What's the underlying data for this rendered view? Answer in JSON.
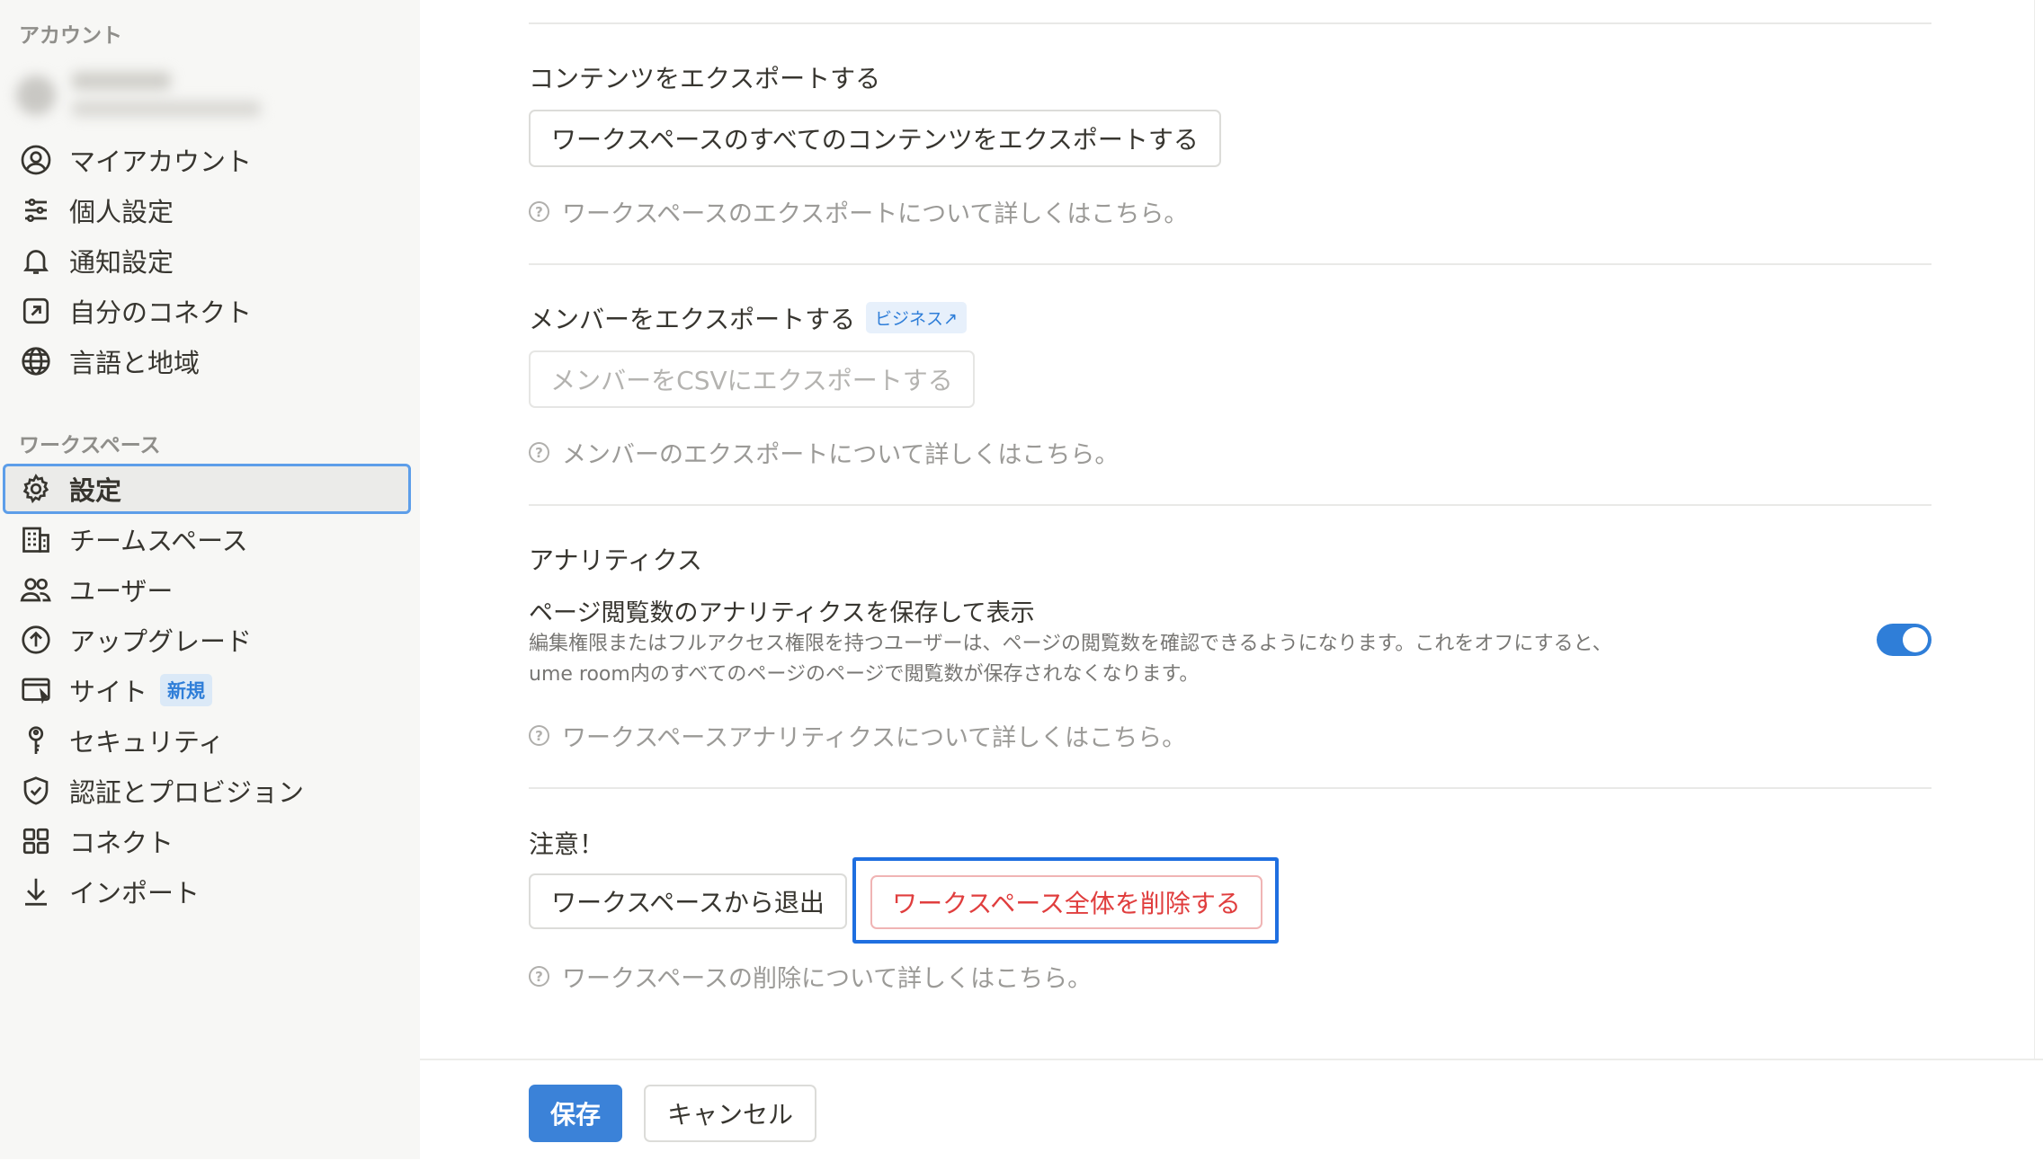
{
  "sidebar": {
    "account_heading": "アカウント",
    "account_items": [
      {
        "label": "マイアカウント",
        "icon": "user-circle-icon"
      },
      {
        "label": "個人設定",
        "icon": "sliders-icon"
      },
      {
        "label": "通知設定",
        "icon": "bell-icon"
      },
      {
        "label": "自分のコネクト",
        "icon": "arrow-box-icon"
      },
      {
        "label": "言語と地域",
        "icon": "globe-icon"
      }
    ],
    "workspace_heading": "ワークスペース",
    "workspace_items": [
      {
        "label": "設定",
        "icon": "gear-icon",
        "active": true
      },
      {
        "label": "チームスペース",
        "icon": "building-icon"
      },
      {
        "label": "ユーザー",
        "icon": "users-icon"
      },
      {
        "label": "アップグレード",
        "icon": "arrow-up-circle-icon"
      },
      {
        "label": "サイト",
        "icon": "browser-icon",
        "badge": "新規"
      },
      {
        "label": "セキュリティ",
        "icon": "key-icon"
      },
      {
        "label": "認証とプロビジョン",
        "icon": "shield-check-icon"
      },
      {
        "label": "コネクト",
        "icon": "grid-icon"
      },
      {
        "label": "インポート",
        "icon": "download-icon"
      }
    ]
  },
  "export_content": {
    "title": "コンテンツをエクスポートする",
    "button": "ワークスペースのすべてのコンテンツをエクスポートする",
    "help": "ワークスペースのエクスポートについて詳しくはこちら。"
  },
  "export_members": {
    "title": "メンバーをエクスポートする",
    "badge": "ビジネス↗",
    "button": "メンバーをCSVにエクスポートする",
    "help": "メンバーのエクスポートについて詳しくはこちら。"
  },
  "analytics": {
    "title": "アナリティクス",
    "setting_title": "ページ閲覧数のアナリティクスを保存して表示",
    "desc_line1": "編集権限またはフルアクセス権限を持つユーザーは、ページの閲覧数を確認できるようになります。これをオフにすると、",
    "desc_line2": "ume room内のすべてのページのページで閲覧数が保存されなくなります。",
    "toggle_on": true,
    "help": "ワークスペースアナリティクスについて詳しくはこちら。"
  },
  "danger": {
    "title": "注意！",
    "leave_button": "ワークスペースから退出",
    "delete_button": "ワークスペース全体を削除する",
    "help": "ワークスペースの削除について詳しくはこちら。"
  },
  "footer": {
    "save": "保存",
    "cancel": "キャンセル"
  },
  "help_icon_glyph": "?",
  "colors": {
    "accent": "#2f7ed8",
    "danger": "#e03e3e",
    "highlight": "#1f6fe0"
  }
}
